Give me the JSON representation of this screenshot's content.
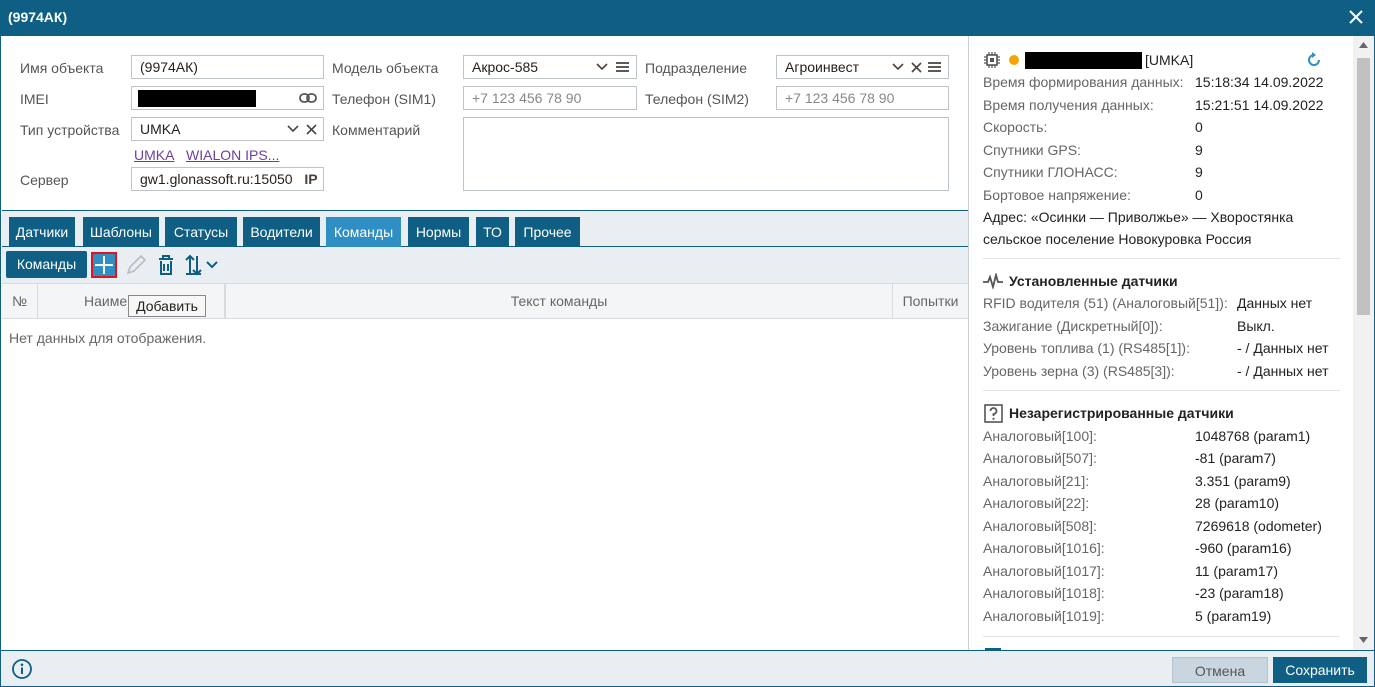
{
  "window": {
    "title": "(9974АК)"
  },
  "form": {
    "name_label": "Имя объекта",
    "name_value": "(9974АК)",
    "imei_label": "IMEI",
    "device_type_label": "Тип устройства",
    "device_type_value": "UMKA",
    "link_umka": "UMKA",
    "link_wialon": "WIALON IPS...",
    "server_label": "Сервер",
    "server_value": "gw1.glonassoft.ru:15050",
    "server_badge": "IP",
    "model_label": "Модель объекта",
    "model_value": "Акрос-585",
    "phone1_label": "Телефон (SIM1)",
    "phone1_placeholder": "+7 123 456 78 90",
    "comment_label": "Комментарий",
    "division_label": "Подразделение",
    "division_value": "Агроинвест",
    "phone2_label": "Телефон (SIM2)",
    "phone2_placeholder": "+7 123 456 78 90"
  },
  "tabs": [
    {
      "label": "Датчики"
    },
    {
      "label": "Шаблоны"
    },
    {
      "label": "Статусы"
    },
    {
      "label": "Водители"
    },
    {
      "label": "Команды"
    },
    {
      "label": "Нормы"
    },
    {
      "label": "ТО"
    },
    {
      "label": "Прочее"
    }
  ],
  "active_tab": "Команды",
  "toolbar": {
    "commands_label": "Команды",
    "add_tooltip": "Добавить"
  },
  "grid": {
    "columns": [
      "№",
      "Наимен",
      "Текст команды",
      "Попытки"
    ],
    "empty_text": "Нет данных для отображения."
  },
  "info": {
    "device_suffix": "[UMKA]",
    "rows": [
      {
        "label": "Время формирования данных:",
        "value": "15:18:34 14.09.2022"
      },
      {
        "label": "Время получения данных:",
        "value": "15:21:51 14.09.2022"
      },
      {
        "label": "Скорость:",
        "value": "0"
      },
      {
        "label": "Спутники GPS:",
        "value": "9"
      },
      {
        "label": "Спутники ГЛОНАСС:",
        "value": "9"
      },
      {
        "label": "Бортовое напряжение:",
        "value": "0"
      }
    ],
    "address_line1": "Адрес: «Осинки — Приволжье» — Хворостянка",
    "address_line2": "сельское поселение Новокуровка Россия"
  },
  "installed": {
    "title": "Установленные датчики",
    "rows": [
      {
        "label": "RFID водителя (51) (Аналоговый[51]):",
        "value": "Данных нет"
      },
      {
        "label": "Зажигание (Дискретный[0]):",
        "value": "Выкл."
      },
      {
        "label": "Уровень топлива (1) (RS485[1]):",
        "value": "- / Данных нет"
      },
      {
        "label": "Уровень зерна (3) (RS485[3]):",
        "value": "- / Данных нет"
      }
    ]
  },
  "unregistered": {
    "title": "Незарегистрированные датчики",
    "rows": [
      {
        "label": "Аналоговый[100]:",
        "value": "1048768 (param1)"
      },
      {
        "label": "Аналоговый[507]:",
        "value": "-81 (param7)"
      },
      {
        "label": "Аналоговый[21]:",
        "value": "3.351 (param9)"
      },
      {
        "label": "Аналоговый[22]:",
        "value": "28 (param10)"
      },
      {
        "label": "Аналоговый[508]:",
        "value": "7269618 (odometer)"
      },
      {
        "label": "Аналоговый[1016]:",
        "value": "-960 (param16)"
      },
      {
        "label": "Аналоговый[1017]:",
        "value": "11 (param17)"
      },
      {
        "label": "Аналоговый[1018]:",
        "value": "-23 (param18)"
      },
      {
        "label": "Аналоговый[1019]:",
        "value": "5 (param19)"
      }
    ]
  },
  "footer": {
    "cancel_label": "Отмена",
    "save_label": "Сохранить"
  },
  "colors": {
    "primary": "#0e5f83",
    "active_tab": "#2f8ec3",
    "status_dot": "#f5a500",
    "highlight": "#e0161d"
  }
}
